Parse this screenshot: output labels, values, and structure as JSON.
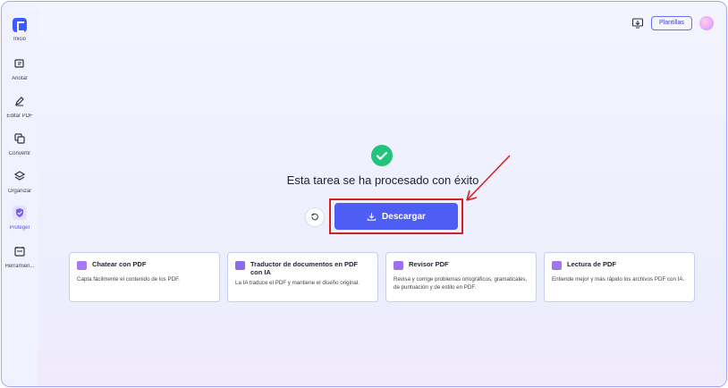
{
  "sidebar": {
    "items": [
      {
        "label": "Inicio",
        "icon": "home-logo-icon"
      },
      {
        "label": "Anotar",
        "icon": "annotate-icon"
      },
      {
        "label": "Editar PDF",
        "icon": "edit-pdf-icon"
      },
      {
        "label": "Convertir",
        "icon": "convert-icon"
      },
      {
        "label": "Organizar",
        "icon": "organize-icon"
      },
      {
        "label": "Proteger",
        "icon": "protect-icon",
        "active": true
      },
      {
        "label": "Herramien...",
        "icon": "tools-icon"
      }
    ]
  },
  "topbar": {
    "templates_label": "Plantillas"
  },
  "main": {
    "status_title": "Esta tarea se ha procesado con éxito",
    "download_label": "Descargar",
    "cards": [
      {
        "title": "Chatear con PDF",
        "desc": "Capta fácilmente el contenido de los PDF.",
        "color": "#a978f5"
      },
      {
        "title": "Traductor de documentos en PDF con IA",
        "desc": "La IA traduce el PDF y mantiene el diseño original.",
        "color": "#8a6cf0"
      },
      {
        "title": "Revisor PDF",
        "desc": "Revisa y corrige problemas ortográficos, gramaticales, de puntuación y de estilo en PDF.",
        "color": "#9d6ef2"
      },
      {
        "title": "Lectura de PDF",
        "desc": "Entiende mejor y más rápido los archivos PDF con IA.",
        "color": "#a374f4"
      }
    ]
  },
  "colors": {
    "accent": "#4e5ef4",
    "success": "#22c37a",
    "highlight": "#d42020"
  }
}
